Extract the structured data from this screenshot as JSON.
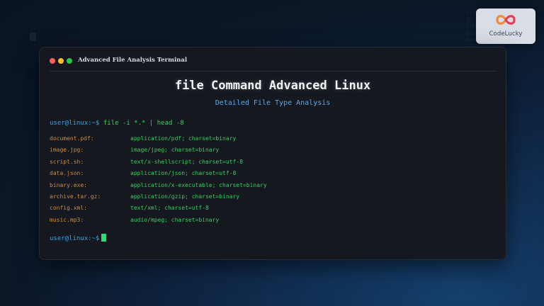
{
  "brand": {
    "name": "CodeLucky",
    "colors": {
      "mark_left": "#f08a3c",
      "mark_right": "#e23d5a"
    }
  },
  "window": {
    "title": "Advanced File Analysis Terminal"
  },
  "header": {
    "title": "file Command Advanced Linux",
    "subtitle": "Detailed File Type Analysis"
  },
  "terminal": {
    "prompt": "user@linux:~$",
    "command": "file -i *.* | head -8",
    "output": [
      {
        "file": "document.pdf:",
        "type": "application/pdf; charset=binary"
      },
      {
        "file": "image.jpg:",
        "type": "image/jpeg; charset=binary"
      },
      {
        "file": "script.sh:",
        "type": "text/x-shellscript; charset=utf-8"
      },
      {
        "file": "data.json:",
        "type": "application/json; charset=utf-8"
      },
      {
        "file": "binary.exe:",
        "type": "application/x-executable; charset=binary"
      },
      {
        "file": "archive.tar.gz:",
        "type": "application/gzip; charset=binary"
      },
      {
        "file": "config.xml:",
        "type": "text/xml; charset=utf-8"
      },
      {
        "file": "music.mp3:",
        "type": "audio/mpeg; charset=binary"
      }
    ],
    "final_prompt": "user@linux:~$"
  },
  "colors": {
    "prompt": "#35a4e8",
    "command": "#32d35a",
    "filename": "#d28a3a",
    "mimetype": "#34cf5c",
    "cursor": "#22e07a"
  }
}
